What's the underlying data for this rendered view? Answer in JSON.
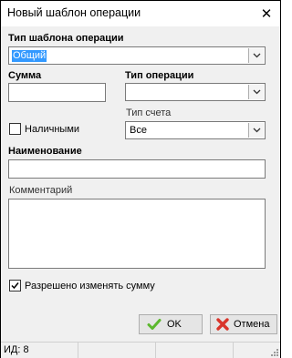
{
  "window": {
    "title": "Новый шаблон операции",
    "close_glyph": "✕"
  },
  "template_type": {
    "label": "Тип шаблона операции",
    "value": "Общий"
  },
  "amount": {
    "label": "Сумма",
    "value": ""
  },
  "operation_type": {
    "label": "Тип операции",
    "value": ""
  },
  "cash": {
    "label": "Наличными",
    "checked": false
  },
  "account_type": {
    "label": "Тип счета",
    "value": "Все"
  },
  "name": {
    "label": "Наименование",
    "value": ""
  },
  "comment": {
    "label": "Комментарий",
    "value": ""
  },
  "allow_change": {
    "label": "Разрешено изменять сумму",
    "checked": true
  },
  "buttons": {
    "ok": "OK",
    "cancel": "Отмена"
  },
  "status": {
    "id_text": "ИД: 8"
  },
  "icons": {
    "ok": "check-icon",
    "cancel": "cross-icon",
    "combo": "chevron-down-icon"
  },
  "colors": {
    "selection": "#3399ff",
    "ok_icon": "#5cb82e",
    "cancel_icon": "#d9352b"
  }
}
